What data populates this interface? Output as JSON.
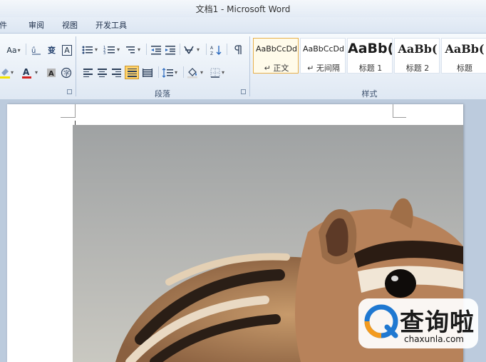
{
  "window": {
    "title": "文档1 - Microsoft Word"
  },
  "tabs": [
    {
      "label": "邮件"
    },
    {
      "label": "审阅"
    },
    {
      "label": "视图"
    },
    {
      "label": "开发工具"
    }
  ],
  "ribbon": {
    "font_group": {
      "change_case": "Aa",
      "phonetic_guide": "ǘ",
      "char_border": "A"
    },
    "paragraph_group": {
      "label": "段落"
    },
    "styles_group": {
      "label": "样式",
      "styles": [
        {
          "sample": "AaBbCcDd",
          "name": "↵ 正文"
        },
        {
          "sample": "AaBbCcDd",
          "name": "↵ 无间隔"
        },
        {
          "sample": "AaBb(",
          "name": "标题 1"
        },
        {
          "sample": "AaBb(",
          "name": "标题 2"
        },
        {
          "sample": "AaBb(",
          "name": "标题"
        }
      ]
    }
  },
  "watermark": {
    "text": "查询啦",
    "url": "chaxunla.com"
  },
  "colors": {
    "accent_selected": "#ffd36b",
    "font_color_red": "#d32020",
    "highlight_yellow": "#f2e200",
    "watermark_blue": "#1f78d1",
    "watermark_orange": "#f39a1e"
  }
}
